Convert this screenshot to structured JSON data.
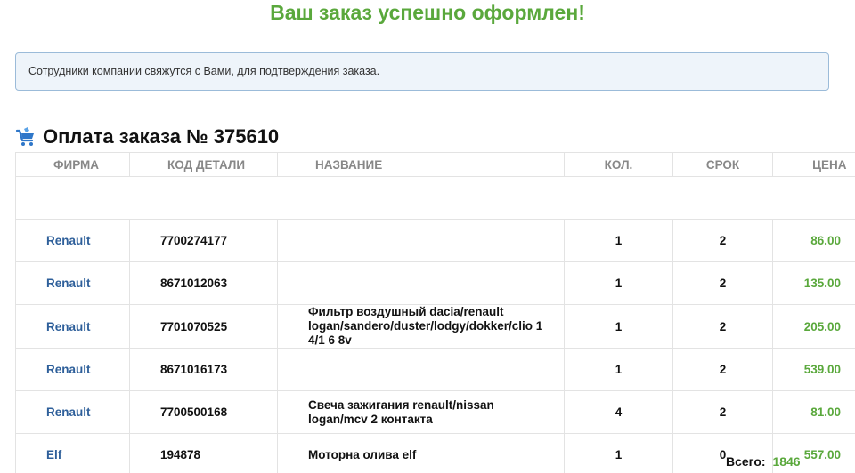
{
  "success_title": "Ваш заказ успешно оформлен!",
  "notice_text": "Сотрудники компании свяжутся с Вами, для подтверждения заказа.",
  "order_heading": "Оплата заказа № 375610",
  "columns": {
    "firm": "ФИРМА",
    "code": "КОД ДЕТАЛИ",
    "name": "НАЗВАНИЕ",
    "qty": "КОЛ.",
    "term": "СРОК",
    "price": "ЦЕНА"
  },
  "rows": [
    {
      "firm": "Renault",
      "code": "7700274177",
      "name": "",
      "qty": "1",
      "term": "2",
      "price": "86.00"
    },
    {
      "firm": "Renault",
      "code": "8671012063",
      "name": "",
      "qty": "1",
      "term": "2",
      "price": "135.00"
    },
    {
      "firm": "Renault",
      "code": "7701070525",
      "name": "Фильтр воздушный dacia/renault logan/sandero/duster/lodgy/dokker/clio 1 4/1 6 8v",
      "qty": "1",
      "term": "2",
      "price": "205.00"
    },
    {
      "firm": "Renault",
      "code": "8671016173",
      "name": "",
      "qty": "1",
      "term": "2",
      "price": "539.00"
    },
    {
      "firm": "Renault",
      "code": "7700500168",
      "name": "Свеча зажигания renault/nissan logan/mcv 2 контакта",
      "qty": "4",
      "term": "2",
      "price": "81.00"
    },
    {
      "firm": "Elf",
      "code": "194878",
      "name": "Моторна олива elf",
      "qty": "1",
      "term": "0",
      "price": "557.00"
    }
  ],
  "total": {
    "label": "Всего:",
    "value": "1846"
  },
  "icons": {
    "heading_icon": "cart-icon"
  },
  "colors": {
    "success_green": "#5aa83c",
    "firm_blue": "#2e5f9a",
    "notice_border": "#9bbbd9"
  }
}
